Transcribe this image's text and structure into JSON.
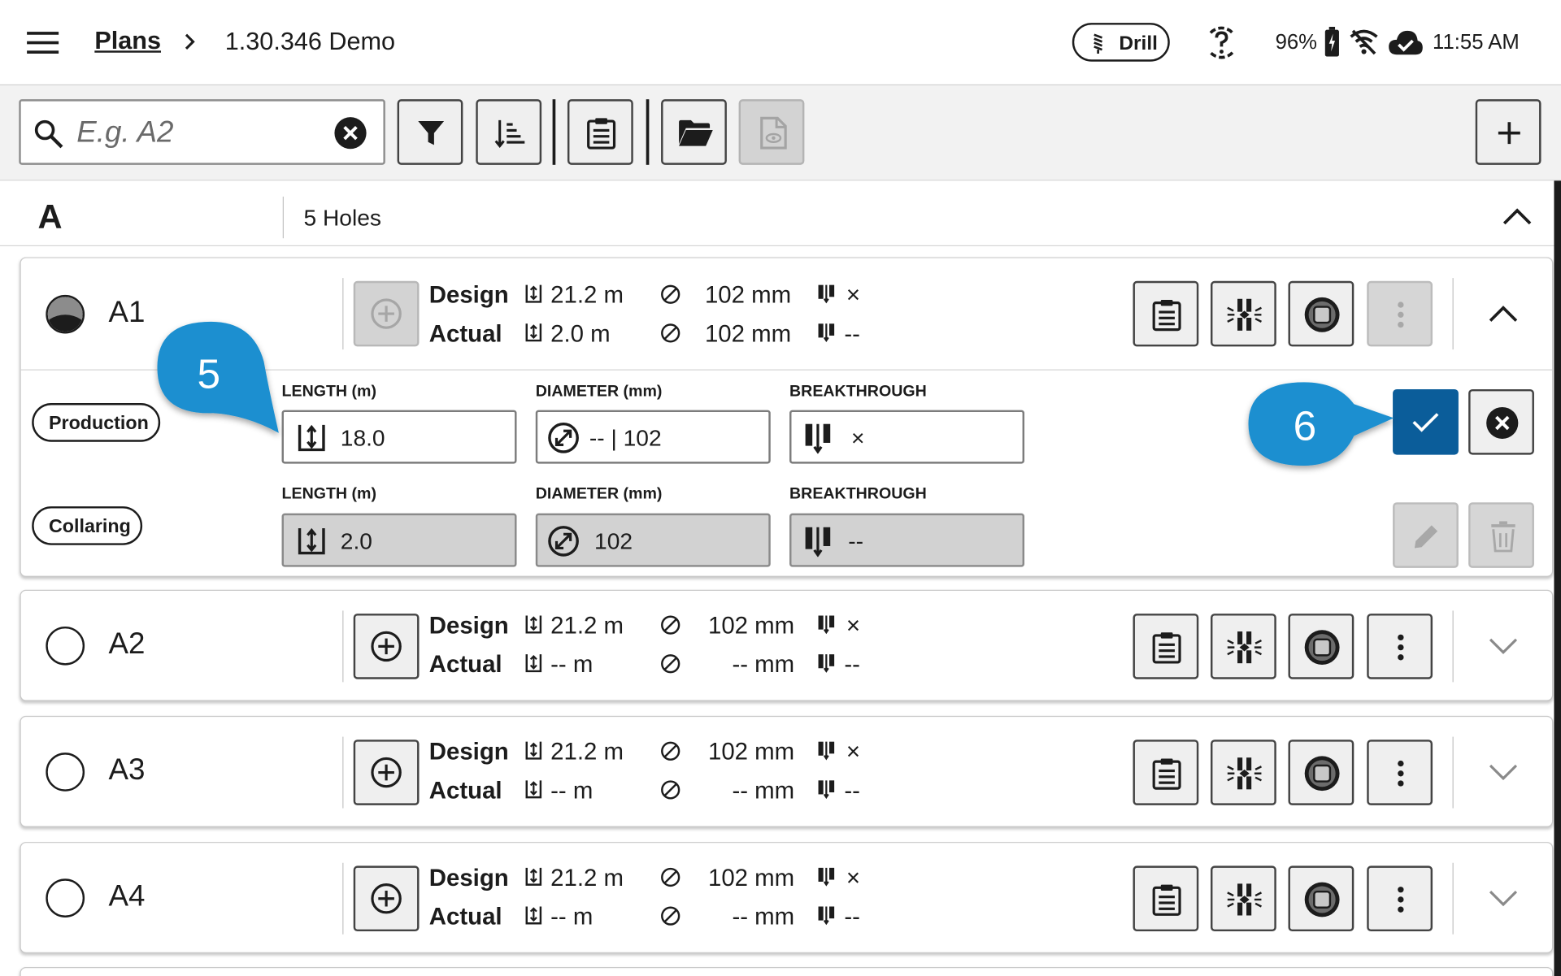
{
  "header": {
    "breadcrumb_link": "Plans",
    "breadcrumb_current": "1.30.346 Demo",
    "drill_label": "Drill",
    "battery": "96%",
    "time": "11:55 AM"
  },
  "toolbar": {
    "search_placeholder": "E.g. A2"
  },
  "group": {
    "letter": "A",
    "count_label": "5 Holes"
  },
  "labels": {
    "design": "Design",
    "actual": "Actual"
  },
  "holes": [
    {
      "name": "A1",
      "design_length": "21.2 m",
      "design_diameter": "102 mm",
      "design_breakthrough": "×",
      "actual_length": "2.0 m",
      "actual_diameter": "102 mm",
      "actual_breakthrough": "--"
    },
    {
      "name": "A2",
      "design_length": "21.2 m",
      "design_diameter": "102 mm",
      "design_breakthrough": "×",
      "actual_length": "-- m",
      "actual_diameter": "-- mm",
      "actual_breakthrough": "--"
    },
    {
      "name": "A3",
      "design_length": "21.2 m",
      "design_diameter": "102 mm",
      "design_breakthrough": "×",
      "actual_length": "-- m",
      "actual_diameter": "-- mm",
      "actual_breakthrough": "--"
    },
    {
      "name": "A4",
      "design_length": "21.2 m",
      "design_diameter": "102 mm",
      "design_breakthrough": "×",
      "actual_length": "-- m",
      "actual_diameter": "-- mm",
      "actual_breakthrough": "--"
    }
  ],
  "edit": {
    "production_label": "Production",
    "collaring_label": "Collaring",
    "length_label": "LENGTH (m)",
    "diameter_label": "DIAMETER (mm)",
    "breakthrough_label": "BREAKTHROUGH",
    "production_length": "18.0",
    "production_diameter": "-- | 102",
    "production_breakthrough": "×",
    "collaring_length": "2.0",
    "collaring_diameter": "102",
    "collaring_breakthrough": "--"
  },
  "callouts": {
    "step_5": "5",
    "step_6": "6"
  },
  "colors": {
    "accent": "#0b5d9a",
    "callout": "#1a8fd0"
  }
}
